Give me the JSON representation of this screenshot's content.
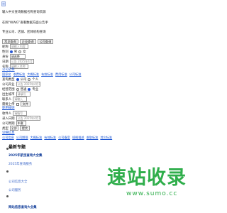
{
  "logo": {
    "icon": "logo-icon"
  },
  "intro": {
    "line1": "输入中文查询数据名称查询资源",
    "line2": "在网“WWG”查看数据方面公告手",
    "line3": "专业公司、店铺、团体机构查询"
  },
  "toolbar": {
    "buttons": [
      "常见查询",
      "企业查询",
      "公司查询"
    ]
  },
  "form": {
    "rows": [
      {
        "label": "昵称",
        "placeholder": "请输入内容"
      },
      {
        "label": "性别",
        "options": [
          "男",
          "女"
        ],
        "selected": "男"
      },
      {
        "label": "身份",
        "value": "请选择"
      },
      {
        "label": "日期",
        "placeholder": "公告 2025年4月1日"
      },
      {
        "label": "名称",
        "placeholder": "请输入名称"
      }
    ],
    "section1_title": "公司名称",
    "links1": [
      "国家名",
      "收费标准",
      "大概标准",
      "有效标准",
      "费用标准",
      "公司标准"
    ],
    "query_type_label": "查询类型",
    "query_type_options": [
      "公司",
      "个人",
      "单位"
    ],
    "query_type_selected": "公司",
    "company_date_label": "公司开业",
    "company_date_value": "公告 2025年4月1日",
    "business_label": "经营范围",
    "business_options": [
      "普通",
      "专业"
    ],
    "business_selected": "专业",
    "birth_label": "出生城市",
    "birth_value": "请填写",
    "contact_label": "联系人",
    "contact_value": "请输入",
    "upload_label": "需要上传",
    "upload_button": "文件",
    "section2_title": "使用规则",
    "receiver_label": "收件人",
    "receiver_value": "请填写",
    "entry_date_label": "录入日期",
    "entry_date_value": "公告 2025年4月1日",
    "cycle_label": "公司周期",
    "cycle_value": "年缴",
    "type_label": "类型",
    "type_value": "全部",
    "submit_button": "提交",
    "section3_title": "详细信息",
    "links2": [
      "公司信息",
      "公司期限",
      "大概标准",
      "有效标准",
      "公司备案",
      "规格描述",
      "收取标准",
      "其它标准"
    ]
  },
  "topics": {
    "title": "最新专题",
    "items": [
      {
        "label": "2025年航宝查询大全集",
        "style": "strong"
      },
      {
        "label": "2025年查询服务",
        "style": "plain"
      },
      {
        "label": "公司信息大全",
        "style": "plain"
      },
      {
        "label": "公司服务",
        "style": "plain"
      },
      {
        "label": "网站信息查询大全集",
        "style": "strong"
      }
    ]
  },
  "watermark": {
    "text": "速站收录",
    "url": "www.sumo.cc",
    "color": "#2fae4b"
  }
}
